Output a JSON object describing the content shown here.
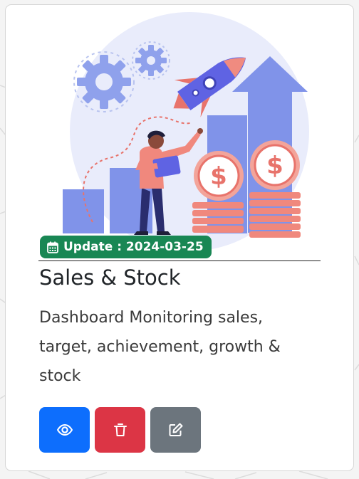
{
  "card": {
    "date_badge": "Update : 2024-03-25",
    "title": "Sales & Stock",
    "description": "Dashboard Monitoring sales, target, achievement, growth & stock",
    "actions": [
      {
        "name": "view",
        "icon": "eye-icon",
        "color": "#0d6efd"
      },
      {
        "name": "delete",
        "icon": "trash-icon",
        "color": "#dc3545"
      },
      {
        "name": "edit",
        "icon": "pencil-square-icon",
        "color": "#6c757d"
      }
    ],
    "badge_color": "#198754",
    "illustration": "growth-rocket-illustration"
  }
}
